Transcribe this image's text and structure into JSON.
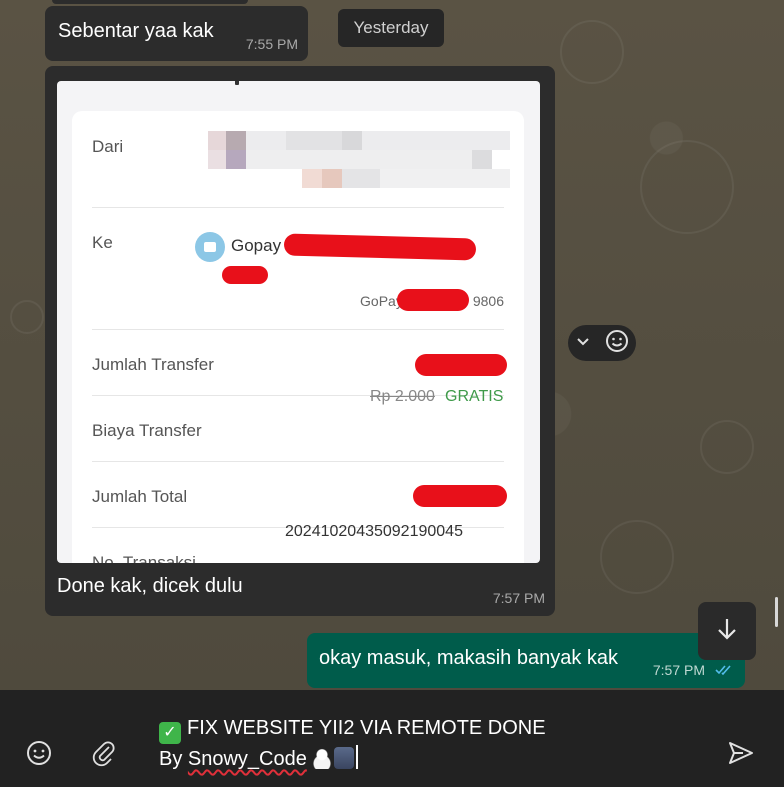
{
  "chat": {
    "date_chip": "Yesterday",
    "messages": [
      {
        "direction": "incoming",
        "text": "Sebentar yaa kak",
        "time": "7:55 PM"
      },
      {
        "direction": "incoming",
        "type": "image",
        "caption": "Done kak, dicek dulu",
        "time": "7:57 PM",
        "receipt": {
          "from_label": "Dari",
          "to_label": "Ke",
          "gopay_name": "Gopay",
          "gopay_id_prefix": "GoPay",
          "gopay_id_suffix": "9806",
          "amount_label": "Jumlah Transfer",
          "fee_label": "Biaya Transfer",
          "fee_original": "Rp 2.000",
          "fee_value": "GRATIS",
          "total_label": "Jumlah Total",
          "trx_label": "No. Transaksi",
          "trx_number": "20241020435092190045"
        }
      },
      {
        "direction": "outgoing",
        "text": "okay masuk, makasih banyak kak",
        "time": "7:57 PM",
        "status": "read"
      }
    ]
  },
  "compose": {
    "line1": "FIX WEBSITE YII2 VIA REMOTE DONE",
    "line2_prefix": "By ",
    "line2_name": "Snowy_Code",
    "emoji_icon": "smiley-icon",
    "attach_icon": "paperclip-icon",
    "send_icon": "send-icon"
  },
  "colors": {
    "incoming_bubble": "#2c2c2c",
    "outgoing_bubble": "#005c4b",
    "read_ticks": "#53bdeb",
    "redaction": "#e8101a",
    "gratis": "#3f9a4a"
  }
}
